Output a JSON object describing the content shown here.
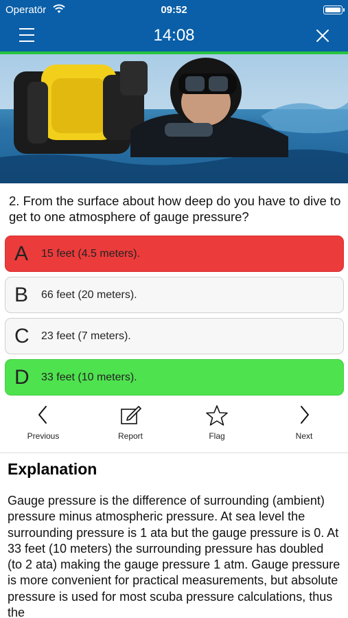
{
  "status_bar": {
    "carrier": "Operatör",
    "time": "09:52"
  },
  "nav": {
    "timer": "14:08"
  },
  "colors": {
    "header_blue": "#0a5fa8",
    "progress_green": "#26c33f",
    "wrong_red": "#ec3b3b",
    "correct_green": "#4fe24f"
  },
  "question": {
    "text": "2. From the surface about how deep do you have to dive to get to one atmosphere of gauge pressure?"
  },
  "answers": [
    {
      "letter": "A",
      "text": "15 feet (4.5 meters).",
      "state": "wrong"
    },
    {
      "letter": "B",
      "text": "66 feet (20 meters).",
      "state": "neutral"
    },
    {
      "letter": "C",
      "text": "23 feet (7 meters).",
      "state": "neutral"
    },
    {
      "letter": "D",
      "text": "33 feet (10 meters).",
      "state": "correct"
    }
  ],
  "toolbar": {
    "previous": {
      "label": "Previous",
      "icon": "chevron-left-icon"
    },
    "report": {
      "label": "Report",
      "icon": "edit-icon"
    },
    "flag": {
      "label": "Flag",
      "icon": "star-icon"
    },
    "next": {
      "label": "Next",
      "icon": "chevron-right-icon"
    }
  },
  "explanation": {
    "title": "Explanation",
    "body": "Gauge pressure is the difference of surrounding (ambient) pressure minus atmospheric pressure. At sea level the surrounding pressure is 1 ata but the gauge pressure is 0. At 33 feet (10 meters) the surrounding pressure has doubled (to 2 ata) making the gauge pressure 1 atm. Gauge pressure is more convenient for practical measurements, but absolute pressure is used for most scuba pressure calculations, thus the"
  }
}
